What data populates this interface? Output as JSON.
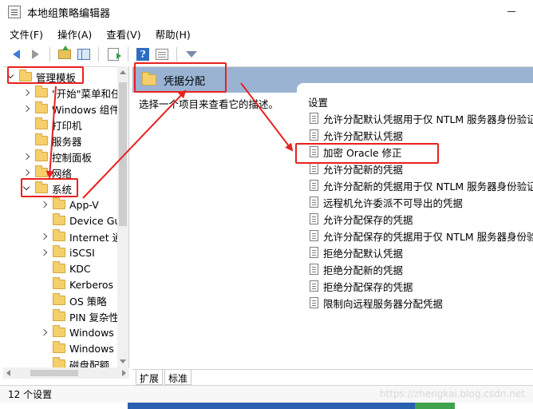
{
  "window": {
    "title": "本地组策略编辑器"
  },
  "menu": [
    "文件(F)",
    "操作(A)",
    "查看(V)",
    "帮助(H)"
  ],
  "toolbar": {
    "icons": [
      "back-icon",
      "forward-icon",
      "up-folder-icon",
      "show-hide-tree-icon",
      "export-list-icon",
      "help-icon",
      "view-icon",
      "filter-icon"
    ]
  },
  "tree": {
    "root": "管理模板",
    "items": [
      {
        "label": "\"开始\"菜单和任",
        "expander": "right"
      },
      {
        "label": "Windows 组件",
        "expander": "right"
      },
      {
        "label": "打印机",
        "expander": "none"
      },
      {
        "label": "服务器",
        "expander": "none"
      },
      {
        "label": "控制面板",
        "expander": "right"
      },
      {
        "label": "网络",
        "expander": "right"
      },
      {
        "label": "系统",
        "expander": "down"
      },
      {
        "label": "App-V",
        "expander": "right"
      },
      {
        "label": "Device Gu",
        "expander": "none"
      },
      {
        "label": "Internet 通",
        "expander": "right"
      },
      {
        "label": "iSCSI",
        "expander": "right"
      },
      {
        "label": "KDC",
        "expander": "none"
      },
      {
        "label": "Kerberos",
        "expander": "none"
      },
      {
        "label": "OS 策略",
        "expander": "none"
      },
      {
        "label": "PIN 复杂性",
        "expander": "none"
      },
      {
        "label": "Windows",
        "expander": "right"
      },
      {
        "label": "Windows",
        "expander": "none"
      },
      {
        "label": "磁盘配额",
        "expander": "none"
      }
    ]
  },
  "right": {
    "header": "凭据分配",
    "description": "选择一个项目来查看它的描述。",
    "settings_heading": "设置",
    "settings": [
      "允许分配默认凭据用于仅 NTLM 服务器身份验证",
      "允许分配默认凭据",
      "加密 Oracle 修正",
      "允许分配新的凭据",
      "允许分配新的凭据用于仅 NTLM 服务器身份验证",
      "远程机允许委派不可导出的凭据",
      "允许分配保存的凭据",
      "允许分配保存的凭据用于仅 NTLM 服务器身份验证",
      "拒绝分配默认凭据",
      "拒绝分配新的凭据",
      "拒绝分配保存的凭据",
      "限制向远程服务器分配凭据"
    ]
  },
  "tabs": [
    "扩展",
    "标准"
  ],
  "status": "12 个设置",
  "watermark": "https://zhengkai.blog.csdn.net",
  "colors": {
    "header_band": "#9ab3d3",
    "annotation_red": "#e8211f",
    "folder": "#f5cf6a"
  }
}
